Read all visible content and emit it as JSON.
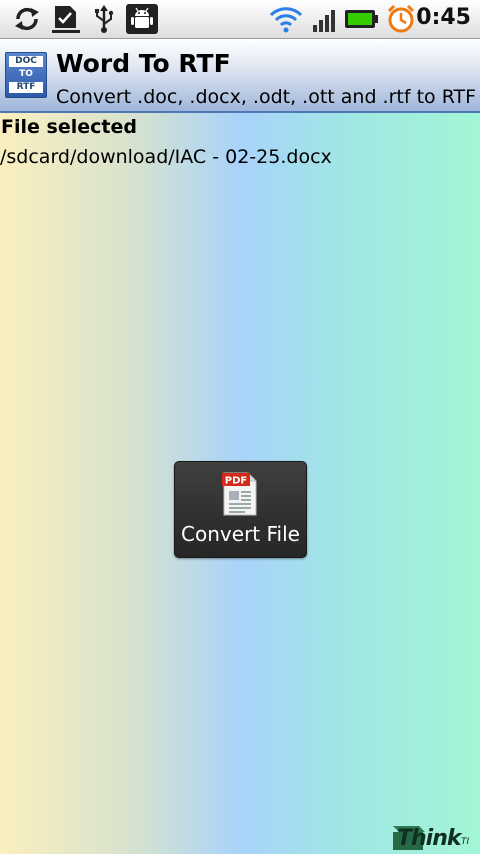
{
  "status_bar": {
    "time": "0:45",
    "icons": [
      "sync-icon",
      "download-complete-icon",
      "usb-icon",
      "android-debug-icon",
      "wifi-icon",
      "signal-icon",
      "battery-icon",
      "alarm-icon"
    ]
  },
  "app": {
    "title": "Word To RTF",
    "subtitle": "Convert .doc, .docx, .odt, .ott and .rtf to RTF",
    "icon_text": [
      "DOC",
      "TO",
      "RTF"
    ]
  },
  "selection": {
    "label": "File selected",
    "path": "/sdcard/download/IAC - 02-25.docx"
  },
  "convert_button": {
    "label": "Convert File",
    "icon_text": "PDF"
  },
  "logo": {
    "text": "Think",
    "suffix": "TI"
  },
  "colors": {
    "header_border": "#4f78b5",
    "button_bg": "#333333",
    "pdf_red": "#d42a1c",
    "battery_green": "#33cc00",
    "wifi_blue": "#2b7fe6",
    "alarm_orange": "#f07a10"
  }
}
